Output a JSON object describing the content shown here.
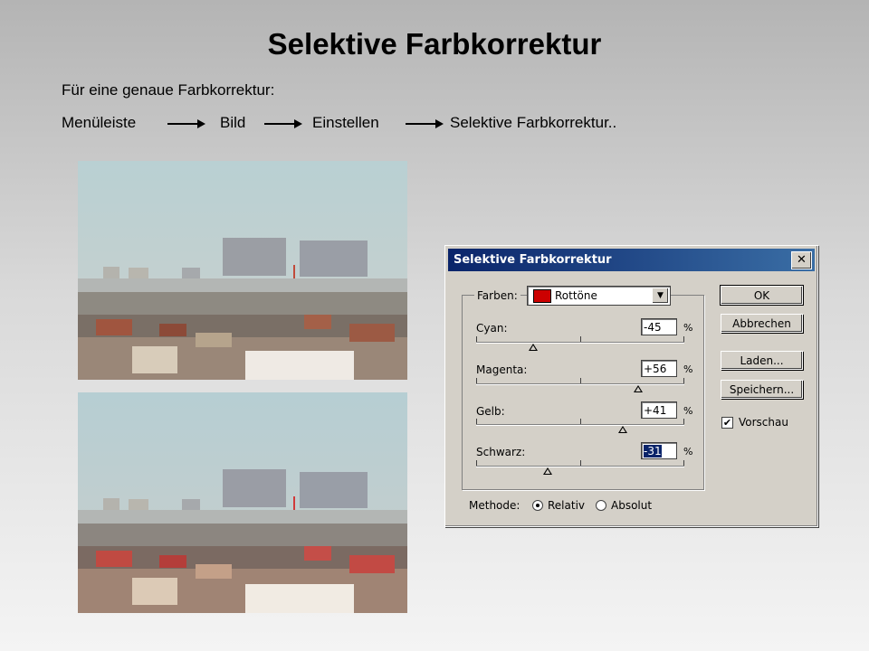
{
  "slide": {
    "title": "Selektive Farbkorrektur",
    "intro": "Für eine genaue Farbkorrektur:",
    "path": [
      "Menüleiste",
      "Bild",
      "Einstellen",
      "Selektive Farbkorrektur.."
    ]
  },
  "dialog": {
    "title": "Selektive Farbkorrektur",
    "close_glyph": "✕",
    "colors_label": "Farben:",
    "colors_value": "Rottöne",
    "colors_swatch": "#cc0000",
    "sliders": [
      {
        "label": "Cyan:",
        "value": "-45",
        "unit": "%"
      },
      {
        "label": "Magenta:",
        "value": "+56",
        "unit": "%"
      },
      {
        "label": "Gelb:",
        "value": "+41",
        "unit": "%"
      },
      {
        "label": "Schwarz:",
        "value": "-31",
        "unit": "%"
      }
    ],
    "buttons": {
      "ok": "OK",
      "cancel": "Abbrechen",
      "load": "Laden...",
      "save": "Speichern..."
    },
    "preview": {
      "label": "Vorschau",
      "checked": true
    },
    "method": {
      "label": "Methode:",
      "relative": "Relativ",
      "absolute": "Absolut",
      "selected": "Relativ"
    }
  }
}
